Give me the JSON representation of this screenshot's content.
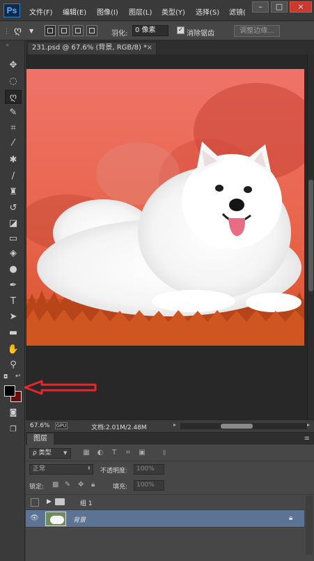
{
  "app": {
    "logo": "Ps"
  },
  "menu": {
    "items": [
      "文件(F)",
      "编辑(E)",
      "图像(I)",
      "图层(L)",
      "类型(Y)",
      "选择(S)",
      "滤镜("
    ]
  },
  "window_controls": {
    "minimize": "–",
    "maximize": "□",
    "close": "×"
  },
  "options": {
    "feather_label": "羽化:",
    "feather_value": "0 像素",
    "antialias_label": "消除锯齿",
    "antialias_checked": true,
    "refine_edge_label": "调整边缘..."
  },
  "document": {
    "tab_title": "231.psd @ 67.6% (背景, RGB/8) *",
    "close": "×"
  },
  "status": {
    "zoom": "67.6%",
    "doc_info": "文档:2.01M/2.48M",
    "nav_icon": "GPU"
  },
  "colors": {
    "foreground": "#000000",
    "background": "#6a0c0c",
    "annotation_arrow": "#e5262c",
    "selection": "#5d7393"
  },
  "layers_panel": {
    "tab_label": "图层",
    "filter_kind": "ρ 类型",
    "blend_mode": "正常",
    "opacity_label": "不透明度:",
    "opacity_value": "100%",
    "lock_label": "锁定:",
    "fill_label": "填充:",
    "fill_value": "100%",
    "layers": [
      {
        "name": "组 1",
        "type": "group",
        "visible": false,
        "selected": false
      },
      {
        "name": "背景",
        "type": "image",
        "visible": true,
        "selected": true
      }
    ]
  },
  "tools": [
    "move-tool",
    "marquee-tool",
    "lasso-tool",
    "quick-selection-tool",
    "crop-tool",
    "eyedropper-tool",
    "spot-healing-tool",
    "brush-tool",
    "clone-stamp-tool",
    "history-brush-tool",
    "eraser-tool",
    "gradient-tool",
    "blur-tool",
    "dodge-tool",
    "pen-tool",
    "type-tool",
    "path-selection-tool",
    "rectangle-tool",
    "hand-tool",
    "zoom-tool"
  ],
  "tool_glyphs": {
    "type-tool": "T"
  }
}
